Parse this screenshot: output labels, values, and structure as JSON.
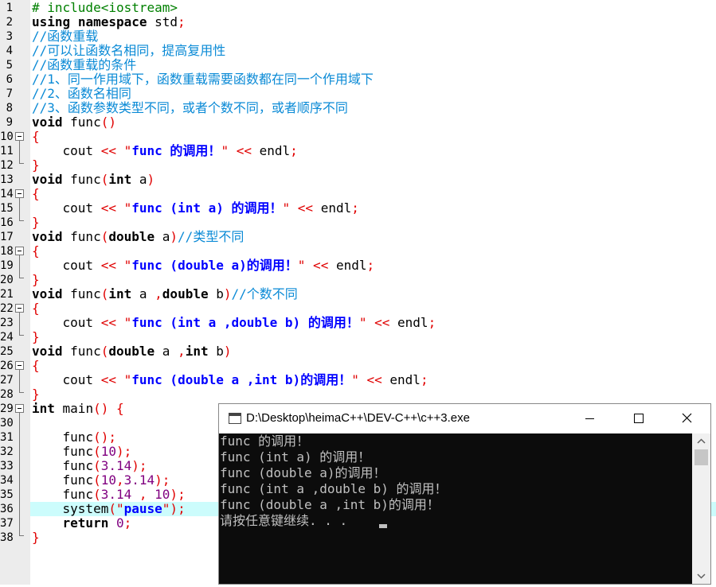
{
  "editor": {
    "lines": [
      {
        "n": "1",
        "t": "# include<iostream>"
      },
      {
        "n": "2",
        "t": "using namespace std;"
      },
      {
        "n": "3",
        "t": "//函数重载"
      },
      {
        "n": "4",
        "t": "//可以让函数名相同，提高复用性"
      },
      {
        "n": "5",
        "t": "//函数重载的条件"
      },
      {
        "n": "6",
        "t": "//1、同一作用域下，函数重载需要函数都在同一个作用域下"
      },
      {
        "n": "7",
        "t": "//2、函数名相同"
      },
      {
        "n": "8",
        "t": "//3、函数参数类型不同，或者个数不同，或者顺序不同"
      },
      {
        "n": "9",
        "t": "void func()"
      },
      {
        "n": "10",
        "t": "{"
      },
      {
        "n": "11",
        "t": "    cout << \"func 的调用！\" << endl;"
      },
      {
        "n": "12",
        "t": "}"
      },
      {
        "n": "13",
        "t": "void func(int a)"
      },
      {
        "n": "14",
        "t": "{"
      },
      {
        "n": "15",
        "t": "    cout << \"func (int a) 的调用！\" << endl;"
      },
      {
        "n": "16",
        "t": "}"
      },
      {
        "n": "17",
        "t": "void func(double a)//类型不同"
      },
      {
        "n": "18",
        "t": "{"
      },
      {
        "n": "19",
        "t": "    cout << \"func (double a)的调用！\" << endl;"
      },
      {
        "n": "20",
        "t": "}"
      },
      {
        "n": "21",
        "t": "void func(int a ,double b)//个数不同"
      },
      {
        "n": "22",
        "t": "{"
      },
      {
        "n": "23",
        "t": "    cout << \"func (int a ,double b) 的调用！\" << endl;"
      },
      {
        "n": "24",
        "t": "}"
      },
      {
        "n": "25",
        "t": "void func(double a ,int b)"
      },
      {
        "n": "26",
        "t": "{"
      },
      {
        "n": "27",
        "t": "    cout << \"func (double a ,int b)的调用！\" << endl;"
      },
      {
        "n": "28",
        "t": "}"
      },
      {
        "n": "29",
        "t": "int main() {"
      },
      {
        "n": "30",
        "t": ""
      },
      {
        "n": "31",
        "t": "    func();"
      },
      {
        "n": "32",
        "t": "    func(10);"
      },
      {
        "n": "33",
        "t": "    func(3.14);"
      },
      {
        "n": "34",
        "t": "    func(10,3.14);"
      },
      {
        "n": "35",
        "t": "    func(3.14 , 10);"
      },
      {
        "n": "36",
        "t": "    system(\"pause\");"
      },
      {
        "n": "37",
        "t": "    return 0;"
      },
      {
        "n": "38",
        "t": "}"
      }
    ],
    "highlighted_line": "36"
  },
  "console": {
    "title": "D:\\Desktop\\heimaC++\\DEV-C++\\c++3.exe",
    "output": [
      "func 的调用！",
      "func (int a) 的调用！",
      "func (double a)的调用！",
      "func (int a ,double b) 的调用！",
      "func (double a ,int b)的调用！",
      "请按任意键继续. . . "
    ]
  },
  "icons": {
    "minimize": "minimize-icon",
    "maximize": "maximize-icon",
    "close": "close-icon",
    "scroll_up": "chevron-up-icon",
    "scroll_down": "chevron-down-icon"
  }
}
